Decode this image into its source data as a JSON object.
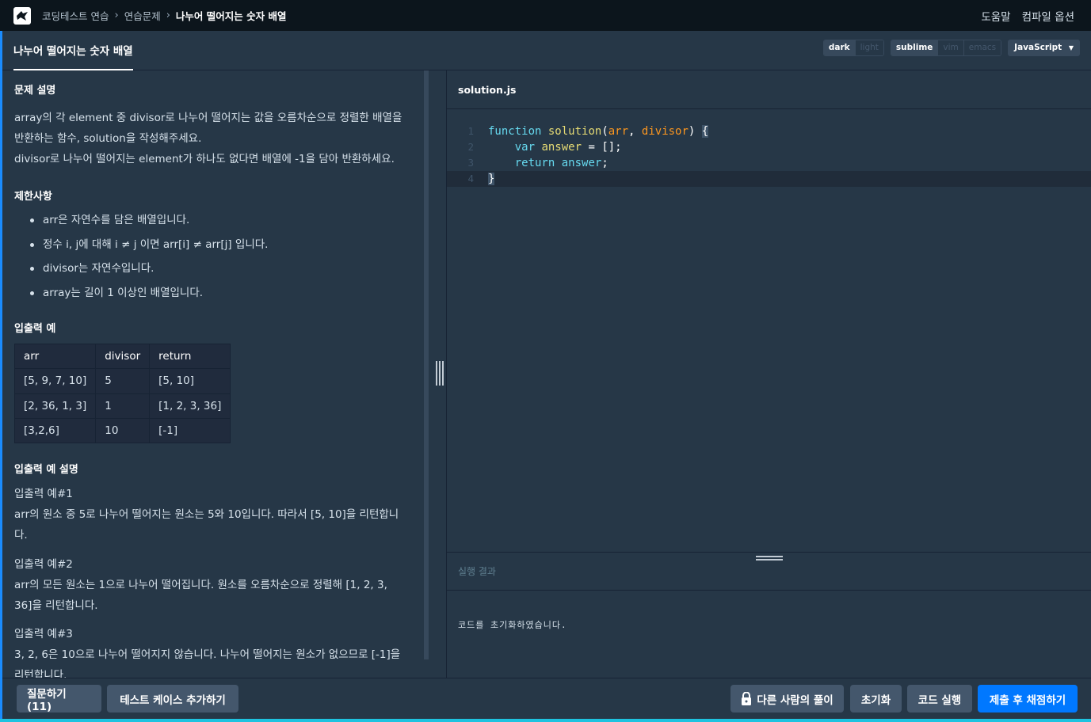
{
  "nav": {
    "breadcrumb": [
      "코딩테스트 연습",
      "연습문제",
      "나누어 떨어지는 숫자 배열"
    ],
    "help": "도움말",
    "compile_options": "컴파일 옵션"
  },
  "tab": {
    "title": "나누어 떨어지는 숫자 배열"
  },
  "toggles": {
    "theme": [
      "dark",
      "light"
    ],
    "keymap": [
      "sublime",
      "vim",
      "emacs"
    ],
    "language": "JavaScript"
  },
  "problem": {
    "desc_title": "문제 설명",
    "desc": [
      "array의 각 element 중 divisor로 나누어 떨어지는 값을 오름차순으로 정렬한 배열을",
      "반환하는 함수, solution을 작성해주세요.",
      "divisor로 나누어 떨어지는 element가 하나도 없다면 배열에 -1을 담아 반환하세요."
    ],
    "constraints_title": "제한사항",
    "constraints": [
      "arr은 자연수를 담은 배열입니다.",
      "정수 i, j에 대해 i ≠ j 이면 arr[i] ≠ arr[j] 입니다.",
      "divisor는 자연수입니다.",
      "array는 길이 1 이상인 배열입니다."
    ],
    "io_title": "입출력 예",
    "io_headers": [
      "arr",
      "divisor",
      "return"
    ],
    "io_rows": [
      [
        "[5, 9, 7, 10]",
        "5",
        "[5, 10]"
      ],
      [
        "[2, 36, 1, 3]",
        "1",
        "[1, 2, 3, 36]"
      ],
      [
        "[3,2,6]",
        "10",
        "[-1]"
      ]
    ],
    "explain_title": "입출력 예 설명",
    "ex1_title": "입출력 예#1",
    "ex1": [
      "arr의 원소 중 5로 나누어 떨어지는 원소는 5와 10입니다. 따라서 [5, 10]을 리턴합니",
      "다."
    ],
    "ex2_title": "입출력 예#2",
    "ex2": [
      "arr의 모든 원소는 1으로 나누어 떨어집니다. 원소를 오름차순으로 정렬해 [1, 2, 3,",
      "36]을 리턴합니다."
    ],
    "ex3_title": "입출력 예#3",
    "ex3": [
      "3, 2, 6은 10으로 나누어 떨어지지 않습니다. 나누어 떨어지는 원소가 없으므로 [-1]을",
      "리턴합니다."
    ]
  },
  "editor": {
    "filename": "solution.js",
    "line_numbers": [
      "1",
      "2",
      "3",
      "4"
    ],
    "code": {
      "l1_kw": "function",
      "l1_fn": "solution",
      "l1_open": "(",
      "l1_a1": "arr",
      "l1_comma": ", ",
      "l1_a2": "divisor",
      "l1_close": ") ",
      "l1_brace": "{",
      "l2_kw": "var",
      "l2_var": "answer",
      "l2_rest": " = [];",
      "l3_kw": "return",
      "l3_var": "answer",
      "l3_rest": ";",
      "l4_brace": "}"
    }
  },
  "result": {
    "title": "실행 결과",
    "message": "코드를 초기화하였습니다."
  },
  "footer": {
    "ask": "질문하기 (11)",
    "add_test": "테스트 케이스 추가하기",
    "others": "다른 사람의 풀이",
    "reset": "초기화",
    "run": "코드 실행",
    "submit": "제출 후 채점하기"
  }
}
